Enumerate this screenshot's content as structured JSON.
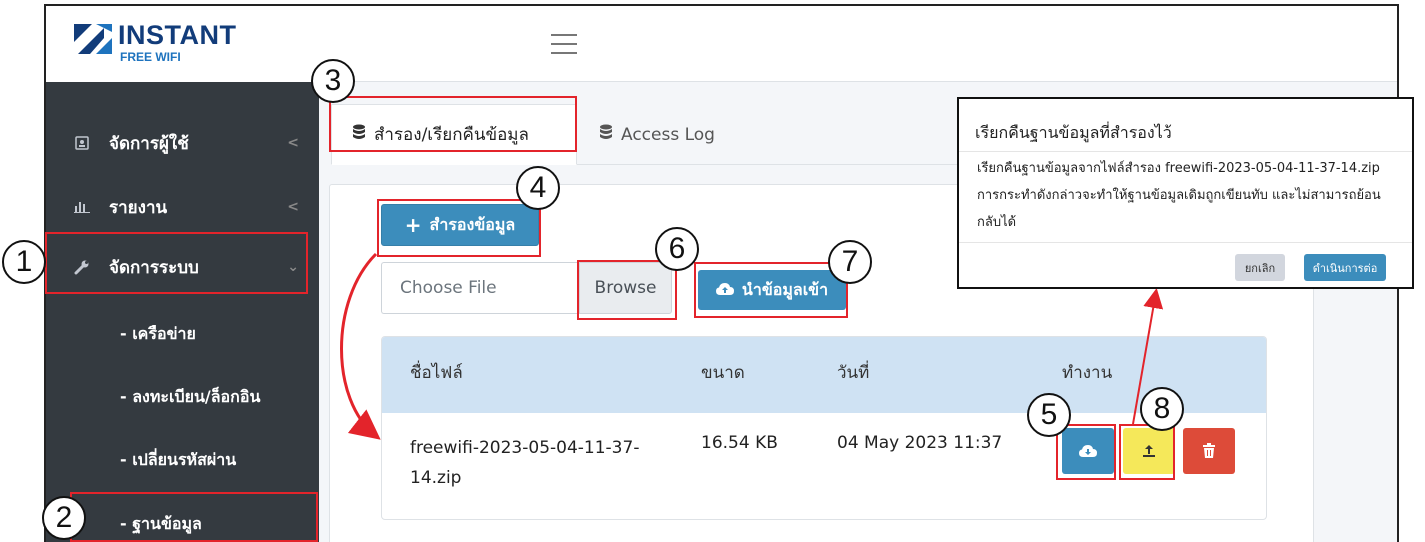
{
  "brand": {
    "name": "INSTANT",
    "subtitle": "FREE WIFI"
  },
  "sidebar": {
    "items": [
      {
        "label": "จัดการผู้ใช้",
        "icon": "user-card-icon",
        "arrow": "<"
      },
      {
        "label": "รายงาน",
        "icon": "bar-chart-icon",
        "arrow": "<"
      },
      {
        "label": "จัดการระบบ",
        "icon": "wrench-icon",
        "arrow": "⌄"
      }
    ],
    "subitems": [
      "- เครือข่าย",
      "- ลงทะเบียน/ล็อกอิน",
      "- เปลี่ยนรหัสผ่าน",
      "- ฐานข้อมูล"
    ]
  },
  "tabs": [
    {
      "label": "สำรอง/เรียกคืนข้อมูล",
      "icon": "database-icon"
    },
    {
      "label": "Access Log",
      "icon": "database-icon"
    }
  ],
  "actions": {
    "backup_label": "สำรองข้อมูล",
    "file_placeholder": "Choose File",
    "browse_label": "Browse",
    "import_label": "นำข้อมูลเข้า"
  },
  "table": {
    "columns": [
      "ชื่อไฟล์",
      "ขนาด",
      "วันที่",
      "ทำงาน"
    ],
    "rows": [
      {
        "filename": "freewifi-2023-05-04-11-37-14.zip",
        "size": "16.54 KB",
        "date": "04 May 2023 11:37"
      }
    ]
  },
  "modal": {
    "title": "เรียกคืนฐานข้อมูลที่สำรองไว้",
    "body": "เรียกคืนฐานข้อมูลจากไฟล์สำรอง freewifi-2023-05-04-11-37-14.zip การกระทำดังกล่าวจะทำให้ฐานข้อมูลเดิมถูกเขียนทับ และไม่สามารถย้อนกลับได้",
    "cancel_label": "ยกเลิก",
    "proceed_label": "ดำเนินการต่อ"
  },
  "annotations": [
    "1",
    "2",
    "3",
    "4",
    "5",
    "6",
    "7",
    "8"
  ],
  "colors": {
    "primary": "#3c8dbc",
    "sidebar": "#343a40",
    "danger": "#dd4b39",
    "warning": "#f5e85a",
    "highlight": "#e3242b"
  }
}
